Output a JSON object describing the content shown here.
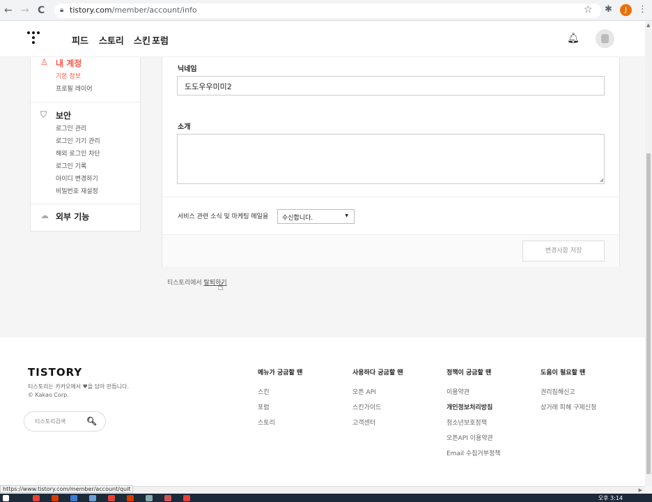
{
  "browser": {
    "back": "←",
    "forward": "→",
    "reload": "C",
    "url_host": "tistory.com",
    "url_path": "/member/account/info",
    "profile_initial": "J",
    "status_url": "https://www.tistory.com/member/account/quit"
  },
  "header": {
    "nav": [
      "피드",
      "스토리",
      "스킨",
      "포럼"
    ]
  },
  "sidebar": {
    "account": {
      "title": "내 계정",
      "items": [
        "기본 정보",
        "프로필 레이어"
      ]
    },
    "security": {
      "title": "보안",
      "items": [
        "로그인 관리",
        "로그인 기기 관리",
        "해외 로그인 차단",
        "로그인 기록",
        "아이디 변경하기",
        "비밀번호 재설정"
      ]
    },
    "external": {
      "title": "외부 기능"
    }
  },
  "form": {
    "nickname_label": "닉네임",
    "nickname_value": "도도우우미미2",
    "intro_label": "소개",
    "mail_label": "서비스 관련 소식 및 마케팅 메일을",
    "mail_option": "수신합니다.",
    "save_label": "변경사항 저장"
  },
  "quit": {
    "prefix": "티스토리에서 ",
    "link": "탈퇴하기"
  },
  "footer": {
    "brand": "TISTORY",
    "desc_line1": "티스토리는 카카오에서 ♥을 담아 만듭니다.",
    "desc_line2": "© Kakao Corp.",
    "search_placeholder": "티스토리검색",
    "columns": [
      {
        "title": "메뉴가 궁금할 땐",
        "links": [
          "스킨",
          "포럼",
          "스토리"
        ]
      },
      {
        "title": "사용하다 궁금할 땐",
        "links": [
          "오픈 API",
          "스킨가이드",
          "고객센터"
        ]
      },
      {
        "title": "정책이 궁금할 땐",
        "links": [
          "이용약관",
          "개인정보처리방침",
          "청소년보호정책",
          "오픈API 이용약관",
          "Email 수집거부정책"
        ]
      },
      {
        "title": "도움이 필요할 땐",
        "links": [
          "권리침해신고",
          "상거래 피해 구제신청"
        ]
      }
    ]
  },
  "taskbar": {
    "time": "오후 3:14"
  }
}
